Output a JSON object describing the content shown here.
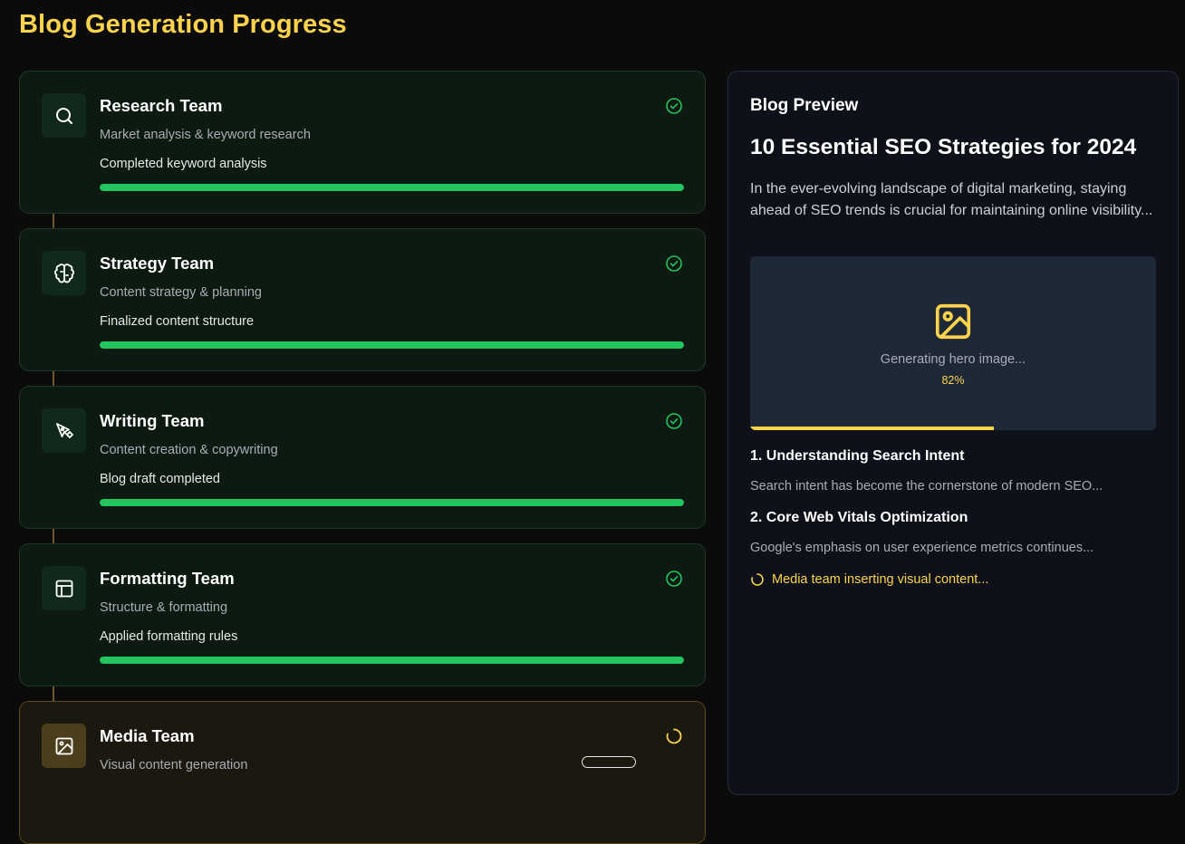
{
  "page": {
    "title": "Blog Generation Progress"
  },
  "colors": {
    "accent": "#fcd34d",
    "success": "#22c55e",
    "background": "#0b0b0c"
  },
  "teams": [
    {
      "name": "Research Team",
      "description": "Market analysis & keyword research",
      "status": "Completed keyword analysis",
      "progress": 100,
      "state": "complete",
      "icon": "search-icon"
    },
    {
      "name": "Strategy Team",
      "description": "Content strategy & planning",
      "status": "Finalized content structure",
      "progress": 100,
      "state": "complete",
      "icon": "brain-icon"
    },
    {
      "name": "Writing Team",
      "description": "Content creation & copywriting",
      "status": "Blog draft completed",
      "progress": 100,
      "state": "complete",
      "icon": "pen-tool-icon"
    },
    {
      "name": "Formatting Team",
      "description": "Structure & formatting",
      "status": "Applied formatting rules",
      "progress": 100,
      "state": "complete",
      "icon": "layout-icon"
    },
    {
      "name": "Media Team",
      "description": "Visual content generation",
      "status": "",
      "progress": null,
      "state": "in-progress",
      "icon": "image-icon"
    }
  ],
  "preview": {
    "heading": "Blog Preview",
    "article_title": "10 Essential SEO Strategies for 2024",
    "intro": "In the ever-evolving landscape of digital marketing, staying ahead of SEO trends is crucial for maintaining online visibility...",
    "hero": {
      "text": "Generating hero image...",
      "percent_label": "82%",
      "progress": 60
    },
    "sections": [
      {
        "title": "1. Understanding Search Intent",
        "text": "Search intent has become the cornerstone of modern SEO..."
      },
      {
        "title": "2. Core Web Vitals Optimization",
        "text": "Google's emphasis on user experience metrics continues..."
      }
    ],
    "media_status": "Media team inserting visual content..."
  }
}
